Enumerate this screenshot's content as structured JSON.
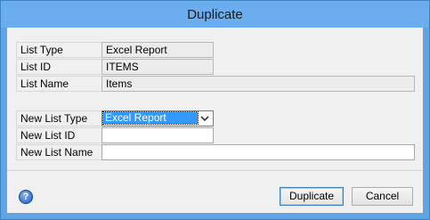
{
  "window": {
    "title": "Duplicate"
  },
  "fields": {
    "list_type": {
      "label": "List Type",
      "value": "Excel Report"
    },
    "list_id": {
      "label": "List ID",
      "value": "ITEMS"
    },
    "list_name": {
      "label": "List Name",
      "value": "Items"
    },
    "new_list_type": {
      "label": "New List Type",
      "value": "Excel Report"
    },
    "new_list_id": {
      "label": "New List ID",
      "value": ""
    },
    "new_list_name": {
      "label": "New List Name",
      "value": ""
    }
  },
  "buttons": {
    "duplicate": "Duplicate",
    "cancel": "Cancel",
    "help": "?"
  }
}
